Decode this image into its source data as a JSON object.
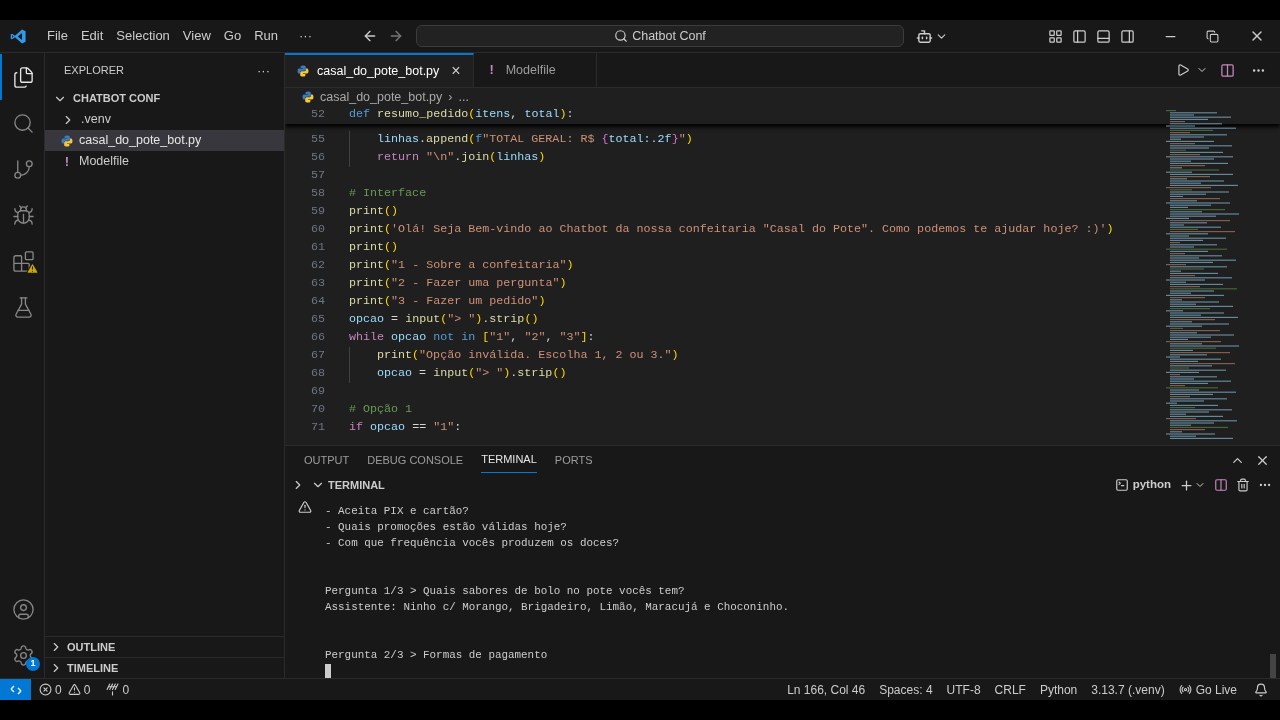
{
  "title_bar": {
    "menu": [
      "File",
      "Edit",
      "Selection",
      "View",
      "Go",
      "Run"
    ],
    "more": "···",
    "search": "Chatbot Conf"
  },
  "activity_bar": {
    "top": [
      {
        "kind": "files",
        "selected": true
      },
      {
        "kind": "search",
        "selected": false
      },
      {
        "kind": "git",
        "selected": false
      },
      {
        "kind": "debug",
        "selected": false
      },
      {
        "kind": "extensions",
        "selected": false,
        "alert": true
      },
      {
        "kind": "testing",
        "selected": false
      }
    ],
    "bottom": [
      {
        "kind": "account"
      },
      {
        "kind": "settings",
        "badge": "1"
      }
    ]
  },
  "sidebar": {
    "title": "EXPLORER",
    "more": "···",
    "tree": [
      {
        "label": "CHATBOT CONF",
        "kind": "root",
        "expanded": true,
        "selected": false,
        "children": [
          {
            "label": ".venv",
            "kind": "folder",
            "expanded": false,
            "selected": false
          },
          {
            "label": "casal_do_pote_bot.py",
            "kind": "python",
            "selected": true
          },
          {
            "label": "Modelfile",
            "kind": "bang",
            "icon_text": "!",
            "selected": false
          }
        ]
      }
    ],
    "sections": [
      {
        "label": "OUTLINE",
        "expanded": false
      },
      {
        "label": "TIMELINE",
        "expanded": false
      }
    ]
  },
  "editor": {
    "tabs": [
      {
        "label": "casal_do_pote_bot.py",
        "kind": "python",
        "selected": true,
        "close": "×"
      },
      {
        "label": "Modelfile",
        "kind": "bang",
        "icon_text": "!",
        "selected": false
      }
    ],
    "breadcrumb": [
      "casal_do_pote_bot.py",
      "›",
      "..."
    ],
    "sticky": {
      "number": "52",
      "indented": false,
      "tokens": [
        {
          "t": "def ",
          "kind": "kw"
        },
        {
          "t": "resumo_pedido",
          "kind": "fn"
        },
        {
          "t": "(",
          "kind": "br"
        },
        {
          "t": "itens",
          "kind": "var"
        },
        {
          "t": ", ",
          "kind": "op"
        },
        {
          "t": "total",
          "kind": "var"
        },
        {
          "t": ")",
          "kind": "br"
        },
        {
          "t": ":",
          "kind": "op"
        }
      ]
    },
    "lines": [
      {
        "number": "55",
        "indented": true,
        "tokens": [
          {
            "t": "linhas",
            "kind": "var"
          },
          {
            "t": ".",
            "kind": "op"
          },
          {
            "t": "append",
            "kind": "fn"
          },
          {
            "t": "(",
            "kind": "br"
          },
          {
            "t": "f",
            "kind": "kw"
          },
          {
            "t": "\"TOTAL GERAL: R$ ",
            "kind": "str"
          },
          {
            "t": "{",
            "kind": "br2"
          },
          {
            "t": "total",
            "kind": "var"
          },
          {
            "t": ":.2f",
            "kind": "num"
          },
          {
            "t": "}",
            "kind": "br2"
          },
          {
            "t": "\"",
            "kind": "str"
          },
          {
            "t": ")",
            "kind": "br"
          }
        ]
      },
      {
        "number": "56",
        "indented": true,
        "tokens": [
          {
            "t": "return ",
            "kind": "ctl"
          },
          {
            "t": "\"\\n\"",
            "kind": "str"
          },
          {
            "t": ".",
            "kind": "op"
          },
          {
            "t": "join",
            "kind": "fn"
          },
          {
            "t": "(",
            "kind": "br"
          },
          {
            "t": "linhas",
            "kind": "var"
          },
          {
            "t": ")",
            "kind": "br"
          }
        ]
      },
      {
        "number": "57",
        "indented": false
      },
      {
        "number": "58",
        "indented": false,
        "tokens": [
          {
            "t": "# Interface",
            "kind": "cmt"
          }
        ]
      },
      {
        "number": "59",
        "indented": false,
        "tokens": [
          {
            "t": "print",
            "kind": "fn"
          },
          {
            "t": "()",
            "kind": "br"
          }
        ]
      },
      {
        "number": "60",
        "indented": false,
        "tokens": [
          {
            "t": "print",
            "kind": "fn"
          },
          {
            "t": "(",
            "kind": "br"
          },
          {
            "t": "'Olá! Seja Bem-vindo ao Chatbot da nossa confeitaria \"Casal do Pote\". Como podemos te ajudar hoje? :)'",
            "kind": "str"
          },
          {
            "t": ")",
            "kind": "br"
          }
        ]
      },
      {
        "number": "61",
        "indented": false,
        "tokens": [
          {
            "t": "print",
            "kind": "fn"
          },
          {
            "t": "()",
            "kind": "br"
          }
        ]
      },
      {
        "number": "62",
        "indented": false,
        "tokens": [
          {
            "t": "print",
            "kind": "fn"
          },
          {
            "t": "(",
            "kind": "br"
          },
          {
            "t": "\"1 - Sobre a confeitaria\"",
            "kind": "str"
          },
          {
            "t": ")",
            "kind": "br"
          }
        ]
      },
      {
        "number": "63",
        "indented": false,
        "tokens": [
          {
            "t": "print",
            "kind": "fn"
          },
          {
            "t": "(",
            "kind": "br"
          },
          {
            "t": "\"2 - Fazer uma pergunta\"",
            "kind": "str"
          },
          {
            "t": ")",
            "kind": "br"
          }
        ]
      },
      {
        "number": "64",
        "indented": false,
        "tokens": [
          {
            "t": "print",
            "kind": "fn"
          },
          {
            "t": "(",
            "kind": "br"
          },
          {
            "t": "\"3 - Fazer um pedido\"",
            "kind": "str"
          },
          {
            "t": ")",
            "kind": "br"
          }
        ]
      },
      {
        "number": "65",
        "indented": false,
        "tokens": [
          {
            "t": "opcao",
            "kind": "var"
          },
          {
            "t": " = ",
            "kind": "op"
          },
          {
            "t": "input",
            "kind": "fn"
          },
          {
            "t": "(",
            "kind": "br"
          },
          {
            "t": "\"> \"",
            "kind": "str"
          },
          {
            "t": ")",
            "kind": "br"
          },
          {
            "t": ".",
            "kind": "op"
          },
          {
            "t": "strip",
            "kind": "fn"
          },
          {
            "t": "()",
            "kind": "br"
          }
        ]
      },
      {
        "number": "66",
        "indented": false,
        "tokens": [
          {
            "t": "while ",
            "kind": "ctl"
          },
          {
            "t": "opcao ",
            "kind": "var"
          },
          {
            "t": "not in ",
            "kind": "kw"
          },
          {
            "t": "[",
            "kind": "br"
          },
          {
            "t": "\"1\"",
            "kind": "str"
          },
          {
            "t": ", ",
            "kind": "op"
          },
          {
            "t": "\"2\"",
            "kind": "str"
          },
          {
            "t": ", ",
            "kind": "op"
          },
          {
            "t": "\"3\"",
            "kind": "str"
          },
          {
            "t": "]",
            "kind": "br"
          },
          {
            "t": ":",
            "kind": "op"
          }
        ]
      },
      {
        "number": "67",
        "indented": true,
        "tokens": [
          {
            "t": "print",
            "kind": "fn"
          },
          {
            "t": "(",
            "kind": "br"
          },
          {
            "t": "\"Opção inválida. Escolha 1, 2 ou 3.\"",
            "kind": "str"
          },
          {
            "t": ")",
            "kind": "br"
          }
        ]
      },
      {
        "number": "68",
        "indented": true,
        "tokens": [
          {
            "t": "opcao",
            "kind": "var"
          },
          {
            "t": " = ",
            "kind": "op"
          },
          {
            "t": "input",
            "kind": "fn"
          },
          {
            "t": "(",
            "kind": "br"
          },
          {
            "t": "\"> \"",
            "kind": "str"
          },
          {
            "t": ")",
            "kind": "br"
          },
          {
            "t": ".",
            "kind": "op"
          },
          {
            "t": "strip",
            "kind": "fn"
          },
          {
            "t": "()",
            "kind": "br"
          }
        ]
      },
      {
        "number": "69",
        "indented": false
      },
      {
        "number": "70",
        "indented": false,
        "tokens": [
          {
            "t": "# Opção 1",
            "kind": "cmt"
          }
        ]
      },
      {
        "number": "71",
        "indented": false,
        "tokens": [
          {
            "t": "if ",
            "kind": "ctl"
          },
          {
            "t": "opcao",
            "kind": "var"
          },
          {
            "t": " == ",
            "kind": "op"
          },
          {
            "t": "\"1\"",
            "kind": "str"
          },
          {
            "t": ":",
            "kind": "op"
          }
        ]
      }
    ]
  },
  "panel": {
    "tabs": [
      {
        "label": "OUTPUT",
        "selected": false
      },
      {
        "label": "DEBUG CONSOLE",
        "selected": false
      },
      {
        "label": "TERMINAL",
        "selected": true
      },
      {
        "label": "PORTS",
        "selected": false
      }
    ],
    "section": {
      "label": "TERMINAL",
      "expanded": true
    },
    "shell": "python",
    "blocks": [
      [
        "- Aceita PIX e cartão?",
        "- Quais promoções estão válidas hoje?",
        "- Com que frequência vocês produzem os doces?"
      ],
      [
        "Pergunta 1/3 > Quais sabores de bolo no pote vocês tem?",
        "Assistente: Ninho c/ Morango, Brigadeiro, Limão, Maracujá e Choconinho."
      ],
      [
        "Pergunta 2/3 > Formas de pagamento"
      ]
    ]
  },
  "status_bar": {
    "errors": "0",
    "warnings": "0",
    "ports": "0",
    "right": [
      {
        "label": "Ln 166, Col 46",
        "kind": "text"
      },
      {
        "label": "Spaces: 4",
        "kind": "text"
      },
      {
        "label": "UTF-8",
        "kind": "text"
      },
      {
        "label": "CRLF",
        "kind": "text"
      },
      {
        "label": "Python",
        "kind": "text"
      },
      {
        "label": "3.13.7 (.venv)",
        "kind": "text"
      },
      {
        "label": "Go Live",
        "kind": "live"
      }
    ]
  }
}
